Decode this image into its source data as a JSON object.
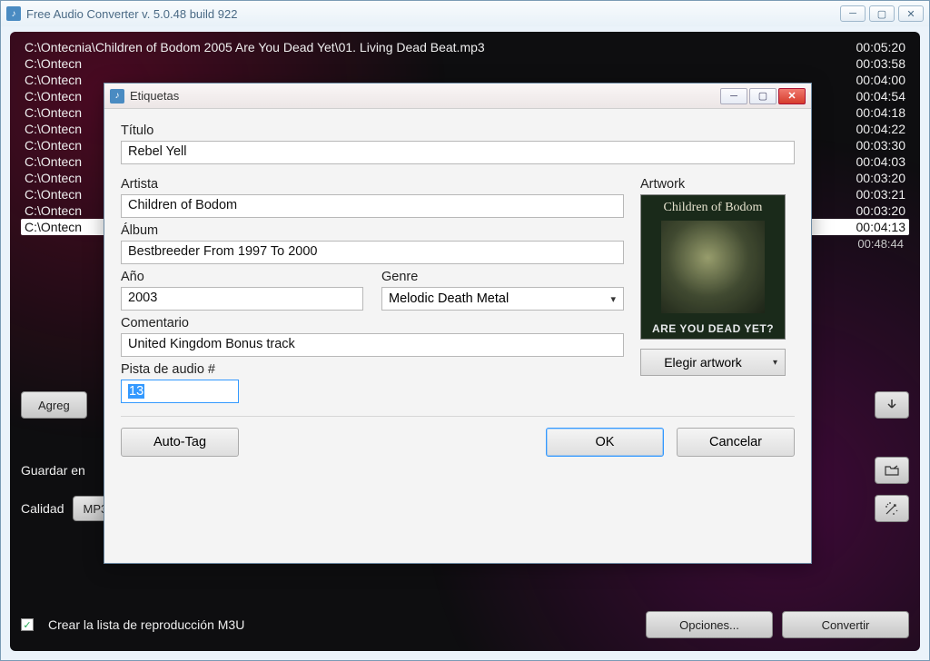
{
  "window": {
    "title": "Free Audio Converter  v. 5.0.48 build 922"
  },
  "tracks": [
    {
      "path": "C:\\Ontecnia\\Children of Bodom 2005 Are You Dead Yet\\01. Living Dead Beat.mp3",
      "duration": "00:05:20"
    },
    {
      "path": "C:\\Ontecn",
      "duration": "00:03:58"
    },
    {
      "path": "C:\\Ontecn",
      "duration": "00:04:00"
    },
    {
      "path": "C:\\Ontecn",
      "duration": "00:04:54"
    },
    {
      "path": "C:\\Ontecn",
      "duration": "00:04:18"
    },
    {
      "path": "C:\\Ontecn",
      "duration": "00:04:22"
    },
    {
      "path": "C:\\Ontecn",
      "duration": "00:03:30"
    },
    {
      "path": "C:\\Ontecn",
      "duration": "00:04:03"
    },
    {
      "path": "C:\\Ontecn",
      "duration": "00:03:20"
    },
    {
      "path": "C:\\Ontecn",
      "duration": "00:03:21"
    },
    {
      "path": "C:\\Ontecn",
      "duration": "00:03:20"
    },
    {
      "path": "C:\\Ontecn",
      "duration": "00:04:13"
    }
  ],
  "total_duration": "00:48:44",
  "toolbar": {
    "add_label": "Agreg",
    "save_label": "Guardar en",
    "quality_label": "Calidad",
    "format": "MP3",
    "playlist_checkbox": "Crear la lista de reproducción M3U",
    "options_label": "Opciones...",
    "convert_label": "Convertir"
  },
  "dialog": {
    "title": "Etiquetas",
    "labels": {
      "titulo": "Título",
      "artista": "Artista",
      "album": "Álbum",
      "ano": "Año",
      "genre": "Genre",
      "comentario": "Comentario",
      "pista": "Pista de audio #",
      "artwork": "Artwork"
    },
    "values": {
      "titulo": "Rebel Yell",
      "artista": "Children of Bodom",
      "album": "Bestbreeder From 1997 To 2000",
      "ano": "2003",
      "genre": "Melodic Death Metal",
      "comentario": "United Kingdom Bonus track",
      "pista": "13"
    },
    "artwork": {
      "band_text": "Children of Bodom",
      "caption": "ARE YOU DEAD YET?"
    },
    "buttons": {
      "choose_artwork": "Elegir artwork",
      "autotag": "Auto-Tag",
      "ok": "OK",
      "cancel": "Cancelar"
    }
  }
}
